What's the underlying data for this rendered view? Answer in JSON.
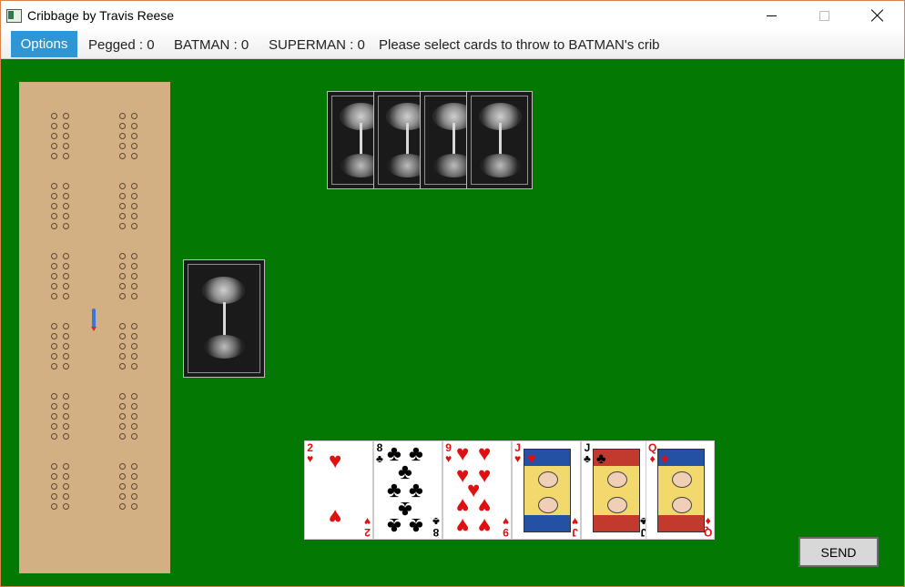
{
  "window": {
    "title": "Cribbage by Travis Reese"
  },
  "menu": {
    "options_label": "Options",
    "pegged": "Pegged : 0",
    "player1_score": "BATMAN : 0",
    "player2_score": "SUPERMAN : 0",
    "status_message": "Please select cards to throw to BATMAN's crib"
  },
  "hand": [
    {
      "rank": "2",
      "suit": "hearts",
      "suit_symbol": "♥",
      "color": "#e01010"
    },
    {
      "rank": "8",
      "suit": "clubs",
      "suit_symbol": "♣",
      "color": "#000000"
    },
    {
      "rank": "9",
      "suit": "hearts",
      "suit_symbol": "♥",
      "color": "#e01010"
    },
    {
      "rank": "J",
      "suit": "hearts",
      "suit_symbol": "♥",
      "color": "#e01010"
    },
    {
      "rank": "J",
      "suit": "clubs",
      "suit_symbol": "♣",
      "color": "#000000"
    },
    {
      "rank": "Q",
      "suit": "diamonds",
      "suit_symbol": "♦",
      "color": "#e01010"
    }
  ],
  "opponent_hand_count": 4,
  "deck_card": "face-down",
  "buttons": {
    "send_label": "SEND"
  },
  "colors": {
    "table": "#037803",
    "board": "#d3b083",
    "accent": "#2f96d6"
  }
}
